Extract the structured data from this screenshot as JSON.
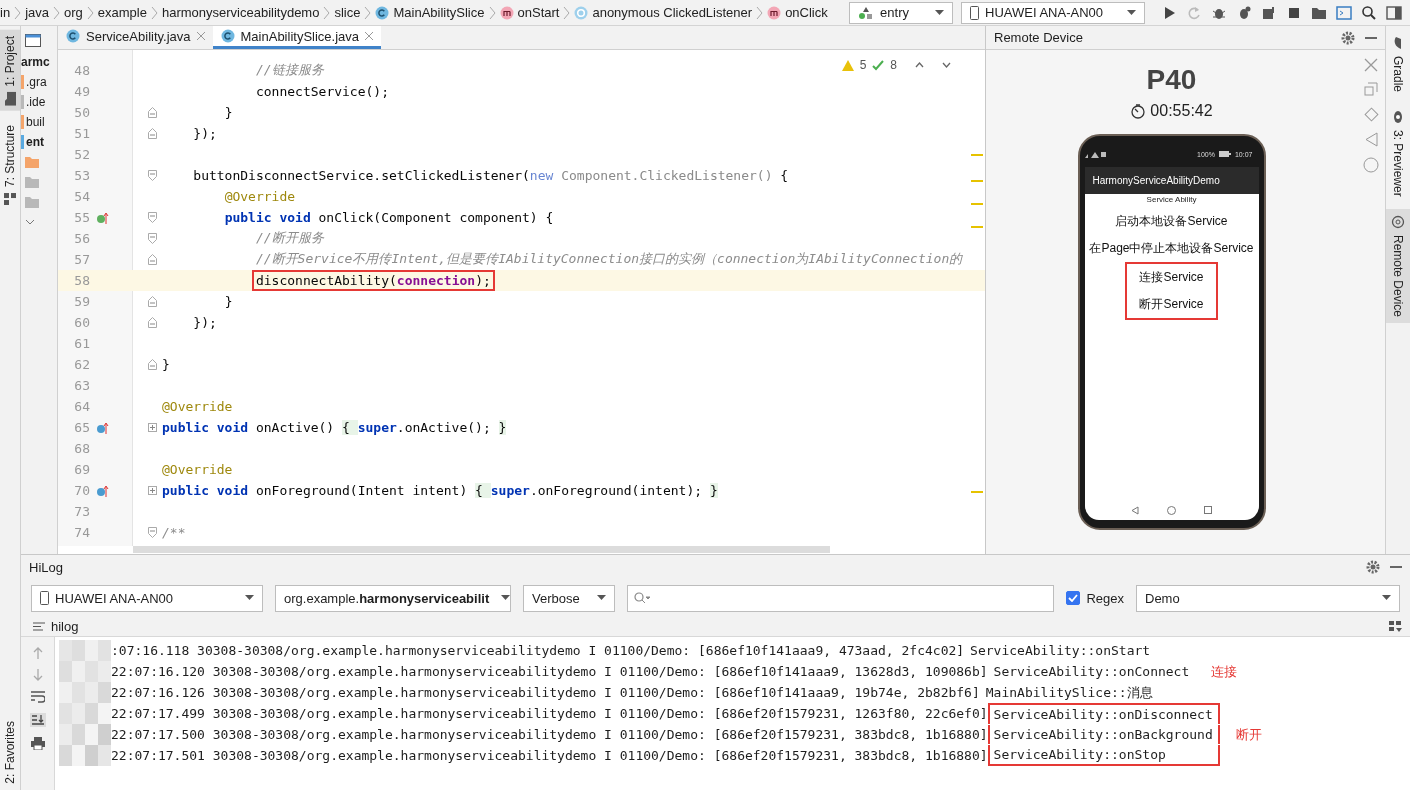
{
  "breadcrumbs": [
    {
      "label": "in",
      "kind": "plain"
    },
    {
      "label": "java",
      "kind": "plain"
    },
    {
      "label": "org",
      "kind": "plain"
    },
    {
      "label": "example",
      "kind": "plain"
    },
    {
      "label": "harmonyserviceabilitydemo",
      "kind": "plain"
    },
    {
      "label": "slice",
      "kind": "plain"
    },
    {
      "label": "MainAbilitySlice",
      "kind": "class"
    },
    {
      "label": "onStart",
      "kind": "method"
    },
    {
      "label": "anonymous ClickedListener",
      "kind": "anonymous"
    },
    {
      "label": "onClick",
      "kind": "method"
    }
  ],
  "run_config": {
    "label": "entry"
  },
  "device_selector": {
    "label": "HUAWEI ANA-AN00"
  },
  "left_strip": [
    {
      "label": "1: Project",
      "selected": true
    },
    {
      "label": "7: Structure",
      "selected": false
    }
  ],
  "favorites": {
    "label": "2: Favorites"
  },
  "project_tree": [
    {
      "label": "armc",
      "kind": "module"
    },
    {
      "label": ".gra",
      "kind": "orange"
    },
    {
      "label": ".ide",
      "kind": "grey"
    },
    {
      "label": "buil",
      "kind": "orange"
    },
    {
      "label": "ent",
      "kind": "source"
    }
  ],
  "editor_tabs": [
    {
      "label": "ServiceAbility.java",
      "selected": false
    },
    {
      "label": "MainAbilitySlice.java",
      "selected": true
    }
  ],
  "inspections": {
    "warnings": "5",
    "weak_warnings": "8"
  },
  "code_lines": [
    {
      "num": "48",
      "current": false,
      "boxed": false,
      "code": [
        {
          "kind": "comment",
          "text": "            //链接服务"
        }
      ]
    },
    {
      "num": "49",
      "current": false,
      "boxed": false,
      "code": [
        {
          "kind": "plain",
          "text": "            connectService();"
        }
      ]
    },
    {
      "num": "50",
      "current": false,
      "boxed": false,
      "fold": {
        "kind": "end"
      },
      "code": [
        {
          "kind": "plain",
          "text": "        }"
        }
      ]
    },
    {
      "num": "51",
      "current": false,
      "boxed": false,
      "fold": {
        "kind": "end"
      },
      "code": [
        {
          "kind": "plain",
          "text": "    });"
        }
      ]
    },
    {
      "num": "52",
      "current": false
    },
    {
      "num": "53",
      "current": false,
      "boxed": false,
      "fold": {
        "kind": "start"
      },
      "code": [
        {
          "kind": "plain",
          "text": "    buttonDisconnectService.setClickedListener("
        },
        {
          "kind": "keyword-light",
          "text": "new "
        },
        {
          "kind": "unused",
          "text": "Component.ClickedListener() "
        },
        {
          "kind": "plain",
          "text": "{"
        }
      ]
    },
    {
      "num": "54",
      "current": false,
      "boxed": false,
      "code": [
        {
          "kind": "annotation",
          "text": "        @Override"
        }
      ]
    },
    {
      "num": "55",
      "current": false,
      "boxed": false,
      "fold": {
        "kind": "start"
      },
      "marker": {
        "kind": "implement"
      },
      "code": [
        {
          "kind": "keyword",
          "text": "        public void "
        },
        {
          "kind": "plain",
          "text": "onClick(Component component) {"
        }
      ]
    },
    {
      "num": "56",
      "current": false,
      "boxed": false,
      "fold": {
        "kind": "start"
      },
      "code": [
        {
          "kind": "comment",
          "text": "            //断开服务"
        }
      ]
    },
    {
      "num": "57",
      "current": false,
      "boxed": false,
      "fold": {
        "kind": "end"
      },
      "code": [
        {
          "kind": "comment",
          "text": "            //断开Service不用传Intent,但是要传IAbilityConnection接口的实例（connection为IAbilityConnection的"
        }
      ]
    },
    {
      "num": "58",
      "current": true,
      "boxed": true,
      "code": [
        {
          "kind": "plain",
          "text": "            disconnectAbility("
        },
        {
          "kind": "field",
          "text": "connection"
        },
        {
          "kind": "plain",
          "text": ");"
        }
      ]
    },
    {
      "num": "59",
      "current": false,
      "boxed": false,
      "fold": {
        "kind": "end"
      },
      "code": [
        {
          "kind": "plain",
          "text": "        }"
        }
      ]
    },
    {
      "num": "60",
      "current": false,
      "boxed": false,
      "fold": {
        "kind": "end"
      },
      "code": [
        {
          "kind": "plain",
          "text": "    });"
        }
      ]
    },
    {
      "num": "61",
      "current": false
    },
    {
      "num": "62",
      "current": false,
      "boxed": false,
      "fold": {
        "kind": "end"
      },
      "code": [
        {
          "kind": "plain",
          "text": "}"
        }
      ]
    },
    {
      "num": "63",
      "current": false
    },
    {
      "num": "64",
      "current": false,
      "boxed": false,
      "code": [
        {
          "kind": "annotation",
          "text": "@Override"
        }
      ]
    },
    {
      "num": "65",
      "current": false,
      "boxed": false,
      "fold": {
        "kind": "collapsed"
      },
      "marker": {
        "kind": "override"
      },
      "code": [
        {
          "kind": "keyword",
          "text": "public void "
        },
        {
          "kind": "plain",
          "text": "onActive() "
        },
        {
          "kind": "folded",
          "text": "{ "
        },
        {
          "kind": "keyword",
          "text": "super"
        },
        {
          "kind": "plain",
          "text": ".onActive(); "
        },
        {
          "kind": "folded",
          "text": "}"
        }
      ]
    },
    {
      "num": "68",
      "current": false
    },
    {
      "num": "69",
      "current": false,
      "boxed": false,
      "code": [
        {
          "kind": "annotation",
          "text": "@Override"
        }
      ]
    },
    {
      "num": "70",
      "current": false,
      "boxed": false,
      "fold": {
        "kind": "collapsed"
      },
      "marker": {
        "kind": "override"
      },
      "code": [
        {
          "kind": "keyword",
          "text": "public void "
        },
        {
          "kind": "plain",
          "text": "onForeground(Intent intent) "
        },
        {
          "kind": "folded",
          "text": "{ "
        },
        {
          "kind": "keyword",
          "text": "super"
        },
        {
          "kind": "plain",
          "text": ".onForeground(intent); "
        },
        {
          "kind": "folded",
          "text": "}"
        }
      ]
    },
    {
      "num": "73",
      "current": false
    },
    {
      "num": "74",
      "current": false,
      "boxed": false,
      "fold": {
        "kind": "start"
      },
      "code": [
        {
          "kind": "comment-doc",
          "text": "/**"
        }
      ]
    }
  ],
  "remote": {
    "title": "Remote Device",
    "device": "P40",
    "timer": "00:55:42",
    "battery": "100%",
    "clock": "10:07",
    "app_title": "HarmonyServiceAbilityDemo",
    "subtitle": "Service Ability",
    "buttons": [
      {
        "label": "启动本地设备Service",
        "boxed": false
      },
      {
        "label": "在Page中停止本地设备Service",
        "boxed": false
      },
      {
        "label": "连接Service",
        "boxed": true
      },
      {
        "label": "断开Service",
        "boxed": true
      }
    ]
  },
  "right_strip": [
    {
      "label": "Gradle",
      "selected": false
    },
    {
      "label": "3: Previewer",
      "selected": false
    },
    {
      "label": "Remote Device",
      "selected": true
    }
  ],
  "hilog": {
    "title": "HiLog",
    "device": "HUAWEI ANA-AN00",
    "package": "org.example.**harmonyserviceabilit**",
    "level": "Verbose",
    "regex": {
      "label": "Regex",
      "checked": true
    },
    "filter": "Demo",
    "tab": "hilog",
    "lines": [
      {
        "prefix": ":07:16.118 30308-30308/org.example.harmonyserviceabilitydemo I 01100/Demo: [686ef10f141aaa9, 473aad, 2fc4c02]",
        "message": "ServiceAbility::onStart",
        "boxed": false
      },
      {
        "prefix": "22:07:16.120 30308-30308/org.example.harmonyserviceabilitydemo I 01100/Demo: [686ef10f141aaa9, 13628d3, 109086b]",
        "message": "ServiceAbility::onConnect",
        "boxed": false,
        "note": "连接"
      },
      {
        "prefix": "22:07:16.126 30308-30308/org.example.harmonyserviceabilitydemo I 01100/Demo: [686ef10f141aaa9, 19b74e, 2b82bf6]",
        "message": "MainAbilitySlice::消息",
        "boxed": false
      },
      {
        "prefix": "22:07:17.499 30308-30308/org.example.harmonyserviceabilitydemo I 01100/Demo: [686ef20f1579231, 1263f80, 22c6ef0]",
        "message": "ServiceAbility::onDisconnect",
        "boxed": true
      },
      {
        "prefix": "22:07:17.500 30308-30308/org.example.harmonyserviceabilitydemo I 01100/Demo: [686ef20f1579231, 383bdc8, 1b16880]",
        "message": "ServiceAbility::onBackground",
        "boxed": true,
        "note": "断开"
      },
      {
        "prefix": "22:07:17.501 30308-30308/org.example.harmonyserviceabilitydemo I 01100/Demo: [686ef20f1579231, 383bdc8, 1b16880]",
        "message": "ServiceAbility::onStop",
        "boxed": true
      }
    ]
  }
}
